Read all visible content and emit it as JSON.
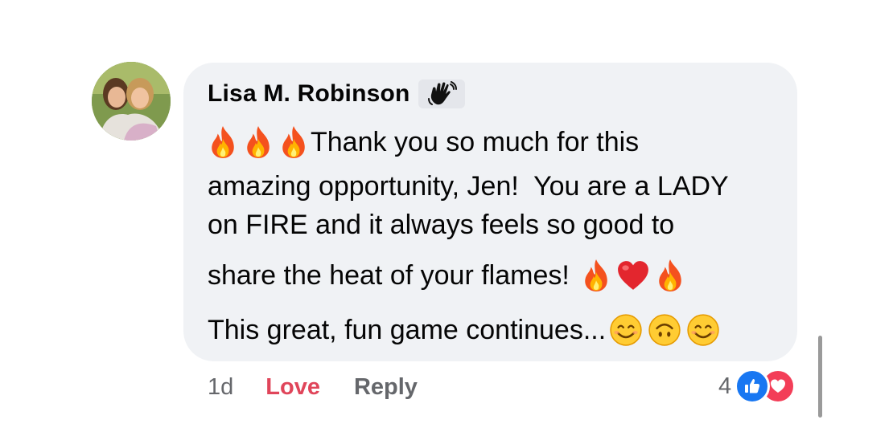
{
  "comment": {
    "author": "Lisa M. Robinson",
    "badge_icon": "waving-hand-icon",
    "lines": [
      "Thank you so much for this",
      "amazing opportunity, Jen!  You are a LADY",
      "on FIRE and it always feels so good to",
      "share the heat of your flames!",
      "This great, fun game continues..."
    ],
    "emojis": {
      "line1_prefix": [
        "fire",
        "fire",
        "fire"
      ],
      "line4_suffix": [
        "fire",
        "red-heart",
        "fire"
      ],
      "line5_suffix": [
        "smiling-face",
        "upside-down-face",
        "smiling-face"
      ]
    }
  },
  "actions": {
    "time": "1d",
    "love_label": "Love",
    "reply_label": "Reply"
  },
  "reactions": {
    "count": "4",
    "types": [
      "like",
      "love"
    ]
  },
  "colors": {
    "bubble": "#f0f2f5",
    "love": "#e0455a",
    "like_blue": "#1877f2",
    "heart_red": "#f33e58"
  }
}
